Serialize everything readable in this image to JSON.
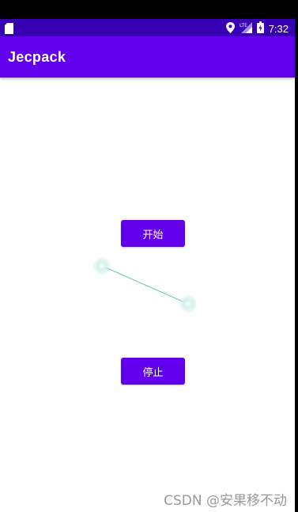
{
  "status_bar": {
    "time": "7:32",
    "icons": [
      "sd-card-icon",
      "location-icon",
      "lte-signal-icon",
      "battery-icon"
    ]
  },
  "app_bar": {
    "title": "Jecpack"
  },
  "buttons": {
    "start_label": "开始",
    "stop_label": "停止"
  },
  "colors": {
    "status_bar": "#3700b3",
    "primary": "#6200ee",
    "dot": "#b8e4e0",
    "line": "#6cc4b6"
  },
  "watermark": "CSDN @安果移不动"
}
